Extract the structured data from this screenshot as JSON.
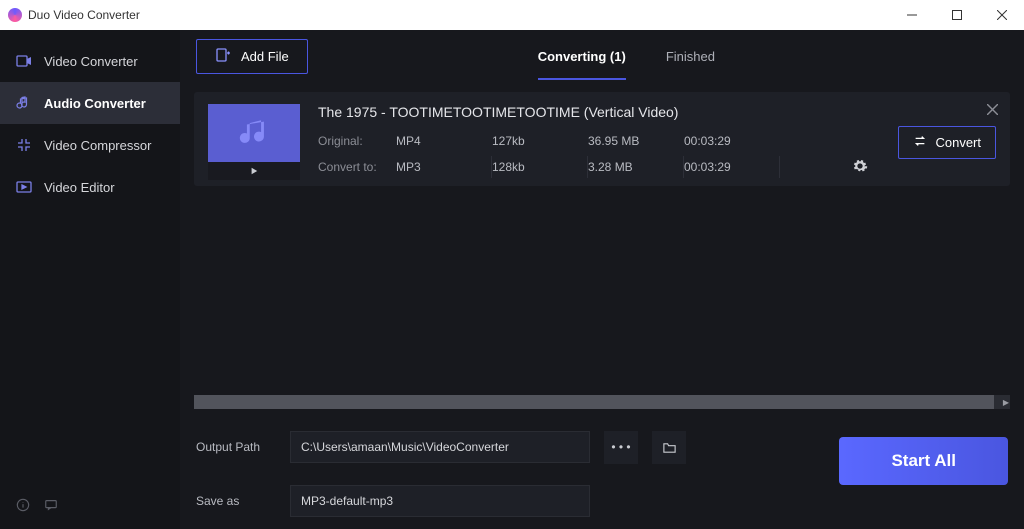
{
  "window": {
    "title": "Duo Video Converter"
  },
  "sidebar": {
    "items": [
      {
        "label": "Video Converter",
        "icon": "video"
      },
      {
        "label": "Audio Converter",
        "icon": "audio"
      },
      {
        "label": "Video Compressor",
        "icon": "compress"
      },
      {
        "label": "Video Editor",
        "icon": "editor"
      }
    ],
    "active_index": 1
  },
  "toolbar": {
    "add_label": "Add File"
  },
  "tabs": {
    "items": [
      {
        "label": "Converting (1)"
      },
      {
        "label": "Finished"
      }
    ],
    "active_index": 0
  },
  "files": [
    {
      "title": "The 1975 - TOOTIMETOOTIMETOOTIME (Vertical Video)",
      "original": {
        "label": "Original:",
        "format": "MP4",
        "bitrate": "127kb",
        "size": "36.95 MB",
        "duration": "00:03:29"
      },
      "convert": {
        "label": "Convert to:",
        "format": "MP3",
        "bitrate": "128kb",
        "size": "3.28 MB",
        "duration": "00:03:29"
      },
      "button": "Convert"
    }
  ],
  "footer": {
    "output_label": "Output Path",
    "output_value": "C:\\Users\\amaan\\Music\\VideoConverter",
    "dots": "• • •",
    "saveas_label": "Save as",
    "saveas_value": "MP3-default-mp3",
    "start_label": "Start All"
  }
}
